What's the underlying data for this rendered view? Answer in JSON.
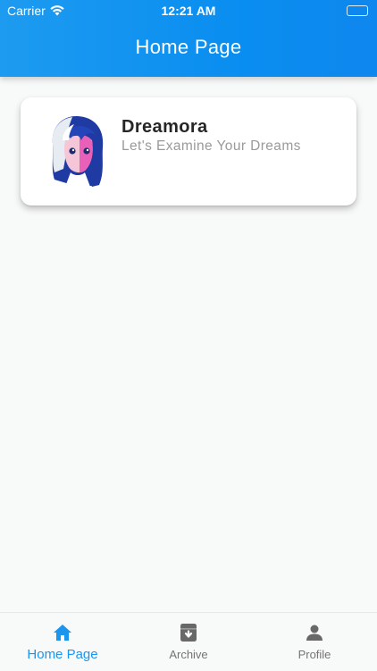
{
  "status_bar": {
    "carrier": "Carrier",
    "time": "12:21 AM"
  },
  "header": {
    "title": "Home Page"
  },
  "card": {
    "app_name": "Dreamora",
    "tagline": "Let's Examine Your Dreams",
    "avatar_icon": "anime-girl-avatar"
  },
  "tab_bar": {
    "tabs": [
      {
        "label": "Home Page",
        "icon": "home-icon",
        "active": true
      },
      {
        "label": "Archive",
        "icon": "archive-icon",
        "active": false
      },
      {
        "label": "Profile",
        "icon": "person-icon",
        "active": false
      }
    ]
  },
  "colors": {
    "primary": "#1d9bf0",
    "active_tab": "#1c95ee",
    "inactive_tab": "#757575",
    "background": "#f8f9f9"
  }
}
